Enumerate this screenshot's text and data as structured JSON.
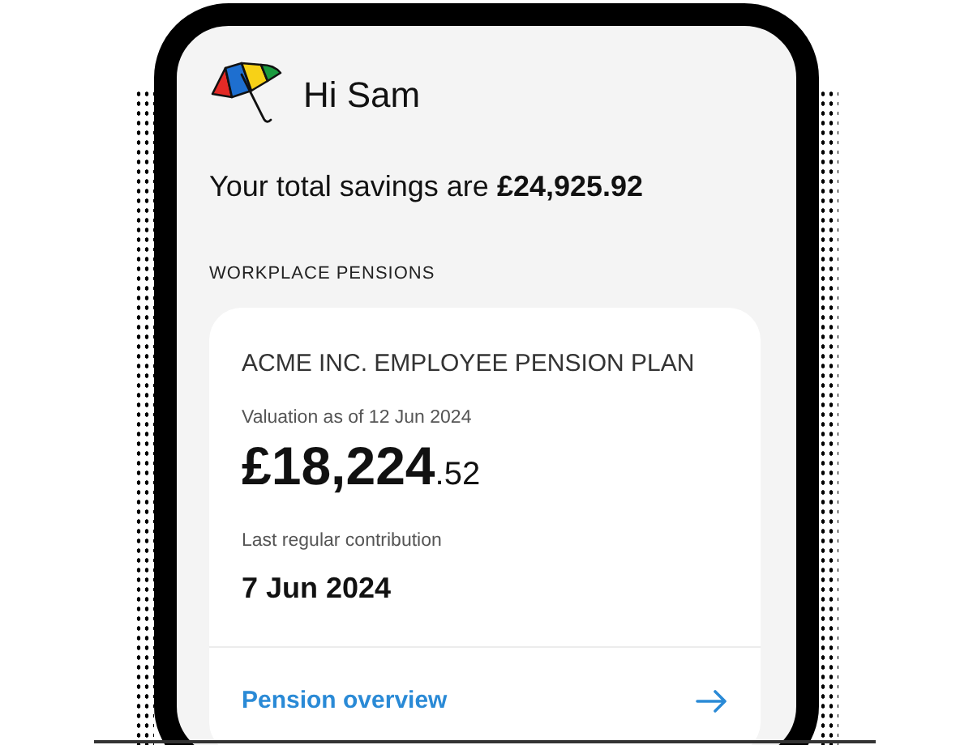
{
  "greeting": "Hi Sam",
  "savings_summary": "Your total savings are **£24,925.92**",
  "section_title": "WORKPLACE PENSIONS",
  "pension_card": {
    "plan_name": "ACME INC. EMPLOYEE PENSION PLAN",
    "valuation_label": "Valuation as of 12 Jun 2024",
    "valuation_pounds": "£18,224",
    "valuation_pence": ".52",
    "contribution_label": "Last regular contribution",
    "contribution_date": "7 Jun 2024",
    "link": "Pension overview"
  }
}
